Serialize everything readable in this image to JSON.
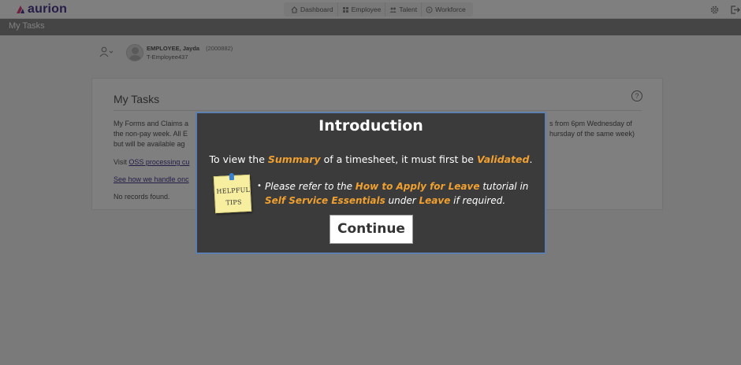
{
  "app": {
    "logo_text": "aurion",
    "brand_color": "#4b3a8f"
  },
  "nav": {
    "items": [
      {
        "label": "Dashboard",
        "icon": "home-icon"
      },
      {
        "label": "Employee",
        "icon": "grid-icon"
      },
      {
        "label": "Talent",
        "icon": "people-icon"
      },
      {
        "label": "Workforce",
        "icon": "workforce-icon"
      }
    ],
    "right_icons": [
      "gear-icon",
      "logout-icon"
    ]
  },
  "titlebar": {
    "title": "My Tasks"
  },
  "employee": {
    "name": "EMPLOYEE, Jayda",
    "id": "(2000882)",
    "role": "T-Employee437"
  },
  "card": {
    "title": "My Tasks",
    "line1_left": "My Forms and Claims a",
    "line1_right": "s from 6pm Wednesday of",
    "line2_left": "the non-pay week. All E",
    "line2_right": "hursday of the same week)",
    "line3": "but will be available ag",
    "visit_prefix": "Visit ",
    "visit_link": "OSS processing cu",
    "see_how": "See how we handle onc",
    "no_records": "No records found."
  },
  "modal": {
    "title": "Introduction",
    "line1_pre": "To view the ",
    "line1_hl1": "Summary",
    "line1_mid": " of a timesheet, it must first be ",
    "line1_hl2": "Validated",
    "line1_post": ".",
    "tips_line1": "HELPFUL",
    "tips_line2": "TIPS",
    "bullet_pre": "Please refer to the ",
    "bullet_hl1": "How to Apply for Leave",
    "bullet_mid1": " tutorial in ",
    "bullet_hl2": "Self Service Essentials",
    "bullet_mid2": " under ",
    "bullet_hl3": "Leave",
    "bullet_post": " if required.",
    "button": "Continue",
    "accent_color": "#f0a030"
  }
}
